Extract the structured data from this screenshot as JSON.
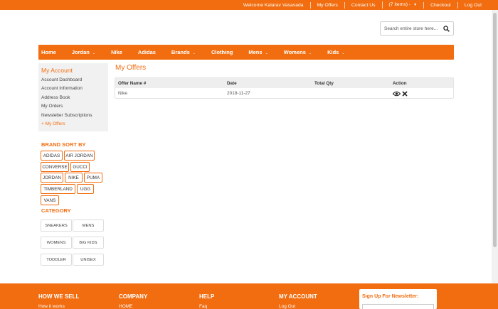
{
  "topbar": {
    "welcome": "Welcome Kalarav Vasavada",
    "my_offers": "My Offers",
    "contact_us": "Contact Us",
    "cart": "(7 items) -",
    "checkout": "Checkout",
    "log_out": "Log Out"
  },
  "search": {
    "placeholder": "Search entire store here..."
  },
  "nav": [
    {
      "label": "Home"
    },
    {
      "label": "Jordan",
      "dropdown": true
    },
    {
      "label": "Nike"
    },
    {
      "label": "Adidas"
    },
    {
      "label": "Brands",
      "dropdown": true
    },
    {
      "label": "Clothing"
    },
    {
      "label": "Mens",
      "dropdown": true
    },
    {
      "label": "Womens",
      "dropdown": true
    },
    {
      "label": "Kids",
      "dropdown": true
    }
  ],
  "account": {
    "title": "My Account",
    "links": [
      "Account Dashboard",
      "Account Information",
      "Address Book",
      "My Orders",
      "Newsletter Subscriptions",
      "+ My Offers"
    ]
  },
  "brand_sort": {
    "title": "BRAND SORT BY",
    "brands": [
      "ADIDAS",
      "AIR JORDAN",
      "CONVERSE",
      "GUCCI",
      "JORDAN",
      "NIKE",
      "PUMA",
      "TIMBERLAND",
      "UGG",
      "VANS"
    ]
  },
  "category": {
    "title": "CATEGORY",
    "items": [
      "SNEAKERS",
      "MENS",
      "WOMENS",
      "BIG KIDS",
      "TODDLER",
      "UNISEX"
    ]
  },
  "main": {
    "title": "My Offers",
    "columns": [
      "Offer Name #",
      "Date",
      "Total Qty",
      "Action"
    ],
    "rows": [
      {
        "offer_name": "Nike",
        "date": "2018-11-27",
        "total_qty": ""
      }
    ]
  },
  "footer": {
    "columns": [
      {
        "heading": "HOW WE SELL",
        "first_link": "How it works"
      },
      {
        "heading": "COMPANY",
        "first_link": "HOME"
      },
      {
        "heading": "HELP",
        "first_link": "Faq"
      },
      {
        "heading": "MY ACCOUNT",
        "first_link": "Log Out"
      }
    ],
    "newsletter_title": "Sign Up For Newsletter:"
  },
  "colors": {
    "accent": "#f26d10"
  }
}
